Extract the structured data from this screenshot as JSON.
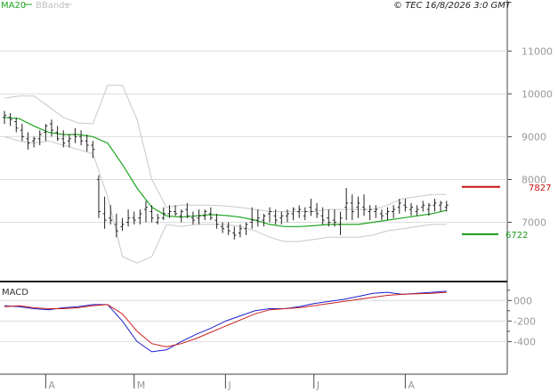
{
  "header": {
    "ma_label": "MA20",
    "bb_label": "BBands",
    "source": "© TEC 16/8/2026 3:0 GMT"
  },
  "colors": {
    "ma": "#1fa51f",
    "bands": "#c8c8c8",
    "candles": "#222222",
    "macd": "#1f1fcc",
    "signal": "#cc1f1f",
    "resistance": "#cc1111",
    "support": "#1a9a1a",
    "grid": "#dddddd"
  },
  "chart_data": [
    {
      "type": "line",
      "title": "",
      "xlabel": "",
      "ylabel": "",
      "ylim": [
        5700,
        11900
      ],
      "y_ticks": [
        "11000",
        "10000",
        "9000",
        "8000",
        "7000"
      ],
      "x_ticks": [
        "A",
        "M",
        "J",
        "J",
        "A"
      ],
      "x_tick_days": [
        14,
        44,
        75,
        105,
        136
      ],
      "legend": "top-left",
      "grid": true,
      "n_days": 155,
      "series": [
        {
          "name": "MA20",
          "kind": "ma",
          "x": [
            0,
            5,
            10,
            15,
            20,
            25,
            30,
            35,
            40,
            45,
            50,
            55,
            60,
            65,
            70,
            75,
            80,
            85,
            90,
            95,
            100,
            105,
            110,
            115,
            120,
            125,
            130,
            135,
            140,
            145,
            150
          ],
          "values": [
            9450,
            9420,
            9250,
            9100,
            9050,
            9050,
            9000,
            8850,
            8350,
            7800,
            7350,
            7150,
            7120,
            7150,
            7180,
            7160,
            7120,
            7050,
            6950,
            6900,
            6900,
            6920,
            6950,
            6950,
            6950,
            7000,
            7050,
            7100,
            7150,
            7200,
            7280
          ]
        },
        {
          "name": "BBands",
          "kind": "band",
          "x": [
            0,
            5,
            10,
            15,
            20,
            25,
            30,
            35,
            40,
            45,
            50,
            55,
            60,
            65,
            70,
            75,
            80,
            85,
            90,
            95,
            100,
            105,
            110,
            115,
            120,
            125,
            130,
            135,
            140,
            145,
            150
          ],
          "upper": [
            9900,
            9950,
            9950,
            9700,
            9450,
            9320,
            9300,
            10200,
            10200,
            9400,
            8000,
            7350,
            7400,
            7400,
            7400,
            7380,
            7350,
            7300,
            7250,
            7250,
            7250,
            7250,
            7300,
            7300,
            7300,
            7300,
            7400,
            7550,
            7600,
            7650,
            7650
          ],
          "lower": [
            9000,
            8900,
            8850,
            8900,
            8800,
            8700,
            8600,
            7600,
            6200,
            6050,
            6200,
            6950,
            6900,
            6950,
            6950,
            6950,
            6900,
            6800,
            6650,
            6550,
            6550,
            6600,
            6650,
            6650,
            6650,
            6700,
            6800,
            6850,
            6900,
            6950,
            6950
          ]
        }
      ],
      "ohlc": {
        "x": [
          0,
          2,
          4,
          6,
          8,
          10,
          12,
          14,
          16,
          18,
          20,
          22,
          24,
          26,
          28,
          30,
          32,
          34,
          36,
          38,
          40,
          42,
          44,
          46,
          48,
          50,
          52,
          54,
          56,
          58,
          60,
          62,
          64,
          66,
          68,
          70,
          72,
          74,
          76,
          78,
          80,
          82,
          84,
          86,
          88,
          90,
          92,
          94,
          96,
          98,
          100,
          102,
          104,
          106,
          108,
          110,
          112,
          114,
          116,
          118,
          120,
          122,
          124,
          126,
          128,
          130,
          132,
          134,
          136,
          138,
          140,
          142,
          144,
          146,
          148,
          150
        ],
        "high": [
          9600,
          9550,
          9450,
          9300,
          9100,
          9000,
          9150,
          9300,
          9400,
          9250,
          9150,
          9050,
          9200,
          9150,
          9050,
          8900,
          8100,
          7600,
          7400,
          7200,
          7100,
          7300,
          7250,
          7300,
          7500,
          7400,
          7200,
          7350,
          7400,
          7400,
          7300,
          7450,
          7250,
          7300,
          7300,
          7350,
          7200,
          7000,
          7000,
          6900,
          6950,
          7000,
          7350,
          7300,
          7200,
          7350,
          7300,
          7250,
          7300,
          7350,
          7400,
          7350,
          7550,
          7450,
          7350,
          7300,
          7300,
          7250,
          7800,
          7650,
          7600,
          7650,
          7400,
          7400,
          7300,
          7350,
          7400,
          7550,
          7550,
          7450,
          7400,
          7500,
          7450,
          7550,
          7500,
          7500
        ],
        "low": [
          9300,
          9250,
          9100,
          8900,
          8700,
          8750,
          8800,
          8900,
          9000,
          8900,
          8750,
          8750,
          8850,
          8800,
          8650,
          8500,
          7100,
          6850,
          6950,
          6650,
          6800,
          6900,
          6950,
          6950,
          7000,
          7000,
          6950,
          7050,
          7100,
          7150,
          7000,
          7100,
          6950,
          6950,
          7050,
          7050,
          6850,
          6750,
          6700,
          6600,
          6650,
          6700,
          6850,
          6900,
          6900,
          7000,
          6950,
          6950,
          7000,
          7050,
          7100,
          7050,
          7150,
          7100,
          6950,
          6900,
          6900,
          6700,
          7050,
          7050,
          7100,
          7150,
          7050,
          7100,
          7050,
          7050,
          7100,
          7200,
          7250,
          7150,
          7150,
          7250,
          7150,
          7250,
          7250,
          7250
        ],
        "open": [
          9450,
          9450,
          9350,
          9150,
          8950,
          8900,
          8950,
          9100,
          9300,
          9100,
          8950,
          8900,
          9050,
          9000,
          8900,
          8800,
          8000,
          7200,
          7100,
          6950,
          6900,
          7000,
          7100,
          7100,
          7300,
          7250,
          7000,
          7100,
          7200,
          7250,
          7150,
          7300,
          7100,
          7100,
          7150,
          7200,
          7050,
          6900,
          6900,
          6750,
          6750,
          6850,
          7000,
          7050,
          7050,
          7200,
          7150,
          7100,
          7150,
          7200,
          7250,
          7150,
          7350,
          7300,
          7150,
          7100,
          7050,
          6950,
          7350,
          7450,
          7350,
          7350,
          7250,
          7250,
          7200,
          7200,
          7250,
          7350,
          7400,
          7300,
          7250,
          7350,
          7300,
          7400,
          7400,
          7350
        ],
        "close": [
          9500,
          9400,
          9200,
          9000,
          8850,
          8950,
          9050,
          9250,
          9150,
          8950,
          8850,
          8950,
          9000,
          8900,
          8800,
          8700,
          7250,
          7050,
          7050,
          6800,
          6950,
          7100,
          7050,
          7200,
          7350,
          7100,
          7100,
          7200,
          7250,
          7200,
          7250,
          7150,
          7050,
          7150,
          7250,
          7100,
          6950,
          6850,
          6800,
          6700,
          6850,
          6950,
          7050,
          7100,
          7150,
          7250,
          7050,
          7150,
          7200,
          7300,
          7300,
          7250,
          7250,
          7200,
          7050,
          7000,
          7000,
          7100,
          7450,
          7250,
          7450,
          7300,
          7300,
          7300,
          7150,
          7250,
          7300,
          7450,
          7350,
          7350,
          7300,
          7400,
          7400,
          7450,
          7450,
          7400
        ]
      },
      "levels": [
        {
          "name": "resistance",
          "value": 7827,
          "label": "7827"
        },
        {
          "name": "support",
          "value": 6722,
          "label": "6722"
        }
      ]
    },
    {
      "type": "line",
      "title": "MACD",
      "xlabel": "",
      "ylabel": "",
      "ylim": [
        -700,
        150
      ],
      "y_ticks": [
        "000",
        "-200",
        "-400"
      ],
      "y_tick_values": [
        0,
        -200,
        -400
      ],
      "grid": true,
      "series": [
        {
          "name": "",
          "kind": "macd",
          "x": [
            0,
            5,
            10,
            15,
            20,
            25,
            30,
            35,
            40,
            45,
            50,
            55,
            60,
            65,
            70,
            75,
            80,
            85,
            90,
            95,
            100,
            105,
            110,
            115,
            120,
            125,
            130,
            135,
            140,
            145,
            150
          ],
          "values": [
            -50,
            -60,
            -80,
            -90,
            -70,
            -60,
            -40,
            -40,
            -200,
            -400,
            -500,
            -480,
            -400,
            -330,
            -270,
            -200,
            -150,
            -100,
            -80,
            -80,
            -60,
            -30,
            -10,
            10,
            40,
            70,
            80,
            60,
            70,
            80,
            90
          ]
        },
        {
          "name": "",
          "kind": "signal",
          "x": [
            0,
            5,
            10,
            15,
            20,
            25,
            30,
            35,
            40,
            45,
            50,
            55,
            60,
            65,
            70,
            75,
            80,
            85,
            90,
            95,
            100,
            105,
            110,
            115,
            120,
            125,
            130,
            135,
            140,
            145,
            150
          ],
          "values": [
            -60,
            -50,
            -70,
            -80,
            -80,
            -70,
            -50,
            -40,
            -130,
            -300,
            -420,
            -450,
            -420,
            -370,
            -310,
            -250,
            -190,
            -130,
            -90,
            -80,
            -70,
            -50,
            -30,
            -10,
            10,
            30,
            50,
            60,
            65,
            70,
            80
          ]
        }
      ]
    }
  ]
}
